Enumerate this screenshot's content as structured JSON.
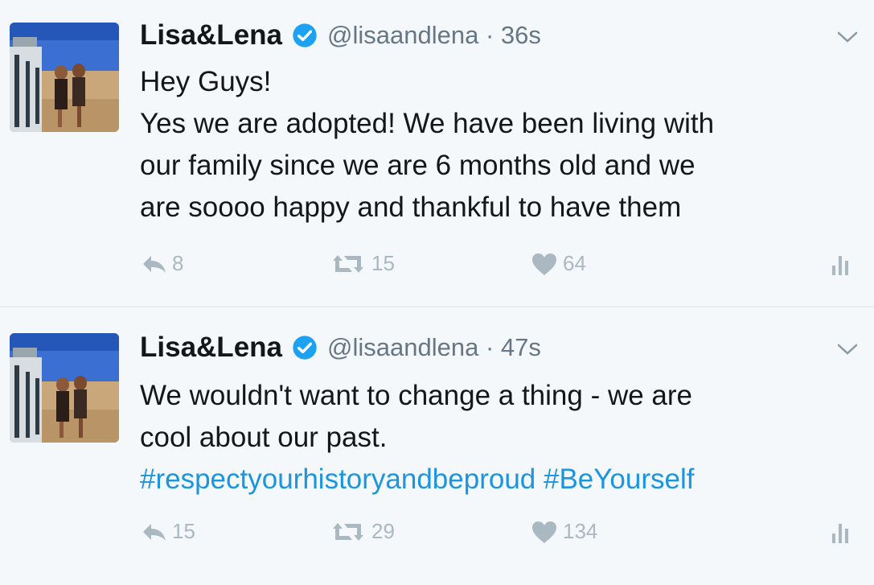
{
  "tweets": [
    {
      "display_name": "Lisa&Lena",
      "handle": "@lisaandlena",
      "time": "36s",
      "lines": [
        "Hey Guys!",
        "Yes we are adopted! We have been living with",
        "our family since we are 6 months old and we",
        "are soooo happy and thankful to have them"
      ],
      "replies": "8",
      "retweets": "15",
      "likes": "64"
    },
    {
      "display_name": "Lisa&Lena",
      "handle": "@lisaandlena",
      "time": "47s",
      "lines": [
        "We wouldn't want to change a thing - we are",
        "cool about our past."
      ],
      "hashtags": [
        "#respectyourhistoryandbeproud",
        "#BeYourself"
      ],
      "replies": "15",
      "retweets": "29",
      "likes": "134"
    }
  ],
  "icons": {
    "verified": "verified-badge-icon",
    "caret": "chevron-down-icon",
    "reply": "reply-icon",
    "retweet": "retweet-icon",
    "like": "heart-icon",
    "stats": "analytics-icon"
  },
  "colors": {
    "background": "#f5f8fa",
    "verified": "#1da1f2",
    "hashtag": "#1b95e0",
    "muted": "#aab8c2",
    "meta": "#657786"
  }
}
